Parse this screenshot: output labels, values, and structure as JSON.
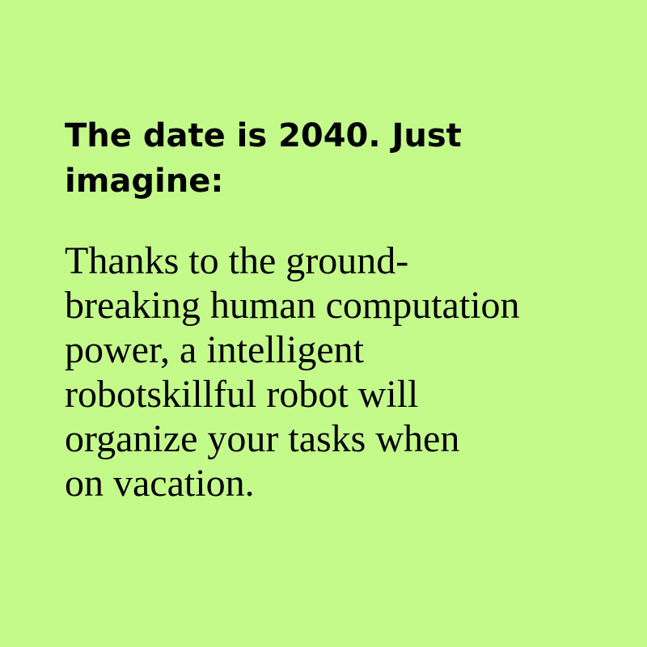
{
  "card": {
    "background_color": "#c4fa8a",
    "text_color": "#000000"
  },
  "heading": {
    "lines": [
      "The date is 2040. Just",
      "imagine:"
    ]
  },
  "body": {
    "lines": [
      "Thanks to the ground-",
      "breaking human computation",
      "power, a intelligent",
      "robotskillful robot will",
      "organize your tasks when",
      "on vacation."
    ]
  }
}
